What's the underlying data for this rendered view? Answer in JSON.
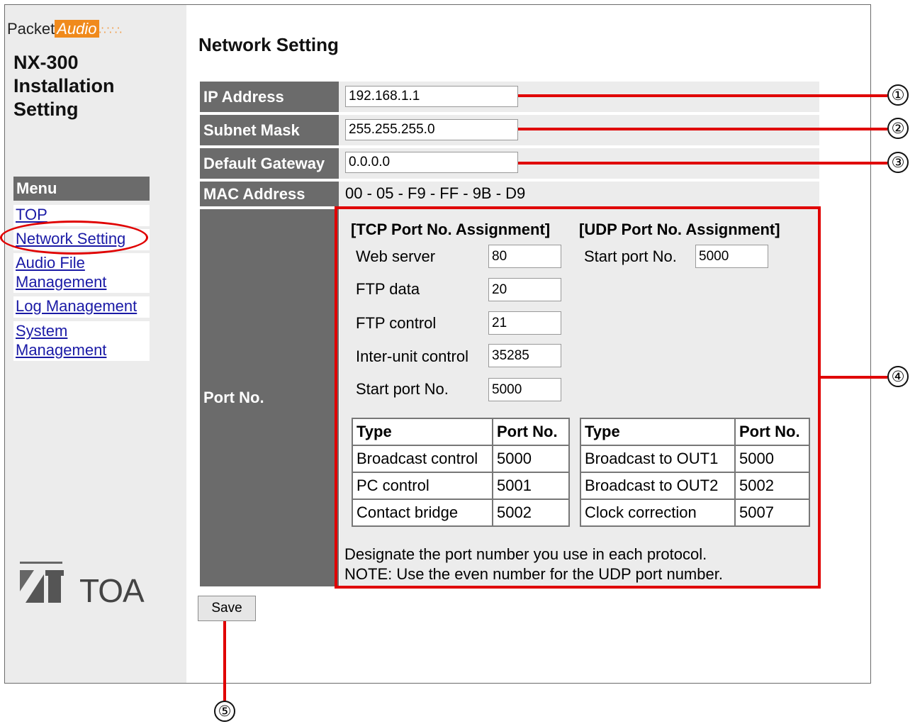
{
  "logo": {
    "packet": "Packet",
    "audio": "Audio"
  },
  "app_title": {
    "line1": "NX-300",
    "line2": "Installation",
    "line3": "Setting"
  },
  "menu": {
    "header": "Menu",
    "items": [
      "TOP",
      "Network Setting",
      "Audio File",
      "Management",
      "Log Management",
      "System",
      "Management"
    ]
  },
  "brand": {
    "text": "TOA"
  },
  "page_title": "Network Setting",
  "fields": {
    "ip_label": "IP Address",
    "ip_value": "192.168.1.1",
    "subnet_label": "Subnet Mask",
    "subnet_value": "255.255.255.0",
    "gateway_label": "Default Gateway",
    "gateway_value": "0.0.0.0",
    "mac_label": "MAC Address",
    "mac_value": "00 - 05 - F9 - FF - 9B - D9",
    "port_label": "Port No."
  },
  "tcp": {
    "heading": "[TCP Port No. Assignment]",
    "web_label": "Web server",
    "web_value": "80",
    "ftpdata_label": "FTP data",
    "ftpdata_value": "20",
    "ftpctrl_label": "FTP control",
    "ftpctrl_value": "21",
    "interunit_label": "Inter-unit control",
    "interunit_value": "35285",
    "start_label": "Start port No.",
    "start_value": "5000",
    "table": {
      "headers": [
        "Type",
        "Port No."
      ],
      "rows": [
        [
          "Broadcast control",
          "5000"
        ],
        [
          "PC control",
          "5001"
        ],
        [
          "Contact bridge",
          "5002"
        ]
      ]
    }
  },
  "udp": {
    "heading": "[UDP Port No. Assignment]",
    "start_label": "Start port No.",
    "start_value": "5000",
    "table": {
      "headers": [
        "Type",
        "Port No."
      ],
      "rows": [
        [
          "Broadcast to OUT1",
          "5000"
        ],
        [
          "Broadcast to OUT2",
          "5002"
        ],
        [
          "Clock correction",
          "5007"
        ]
      ]
    }
  },
  "notes": [
    "Designate the port number you use in each protocol.",
    "NOTE: Use the even number for the UDP port number."
  ],
  "save_label": "Save",
  "callouts": [
    "①",
    "②",
    "③",
    "④",
    "⑤"
  ],
  "colors": {
    "accent_red": "#e00000",
    "label_bg": "#6b6b6b",
    "panel_bg": "#ececec",
    "link": "#1a1aa6",
    "logo_orange": "#f08a1c"
  }
}
